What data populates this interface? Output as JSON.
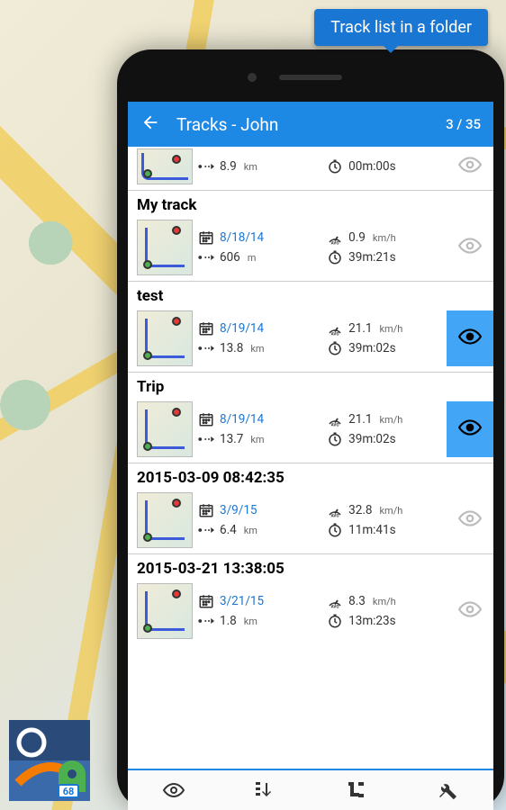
{
  "callout": "Track list in a folder",
  "appbar": {
    "title": "Tracks - John",
    "counter": "3 / 35"
  },
  "tracks": [
    {
      "title": "",
      "partial": true,
      "date": "",
      "distance": "8.9",
      "dist_unit": "km",
      "speed": "",
      "time": "00m:00s",
      "visible": false
    },
    {
      "title": "My track",
      "date": "8/18/14",
      "distance": "606",
      "dist_unit": "m",
      "speed": "0.9",
      "speed_unit": "km/h",
      "time": "39m:21s",
      "visible": false
    },
    {
      "title": "test",
      "date": "8/19/14",
      "distance": "13.8",
      "dist_unit": "km",
      "speed": "21.1",
      "speed_unit": "km/h",
      "time": "39m:02s",
      "visible": true
    },
    {
      "title": "Trip",
      "date": "8/19/14",
      "distance": "13.7",
      "dist_unit": "km",
      "speed": "21.1",
      "speed_unit": "km/h",
      "time": "39m:02s",
      "visible": true
    },
    {
      "title": "2015-03-09 08:42:35",
      "date": "3/9/15",
      "distance": "6.4",
      "dist_unit": "km",
      "speed": "32.8",
      "speed_unit": "km/h",
      "time": "11m:41s",
      "visible": false
    },
    {
      "title": "2015-03-21 13:38:05",
      "date": "3/21/15",
      "distance": "1.8",
      "dist_unit": "km",
      "speed": "8.3",
      "speed_unit": "km/h",
      "time": "13m:23s",
      "visible": false
    }
  ]
}
